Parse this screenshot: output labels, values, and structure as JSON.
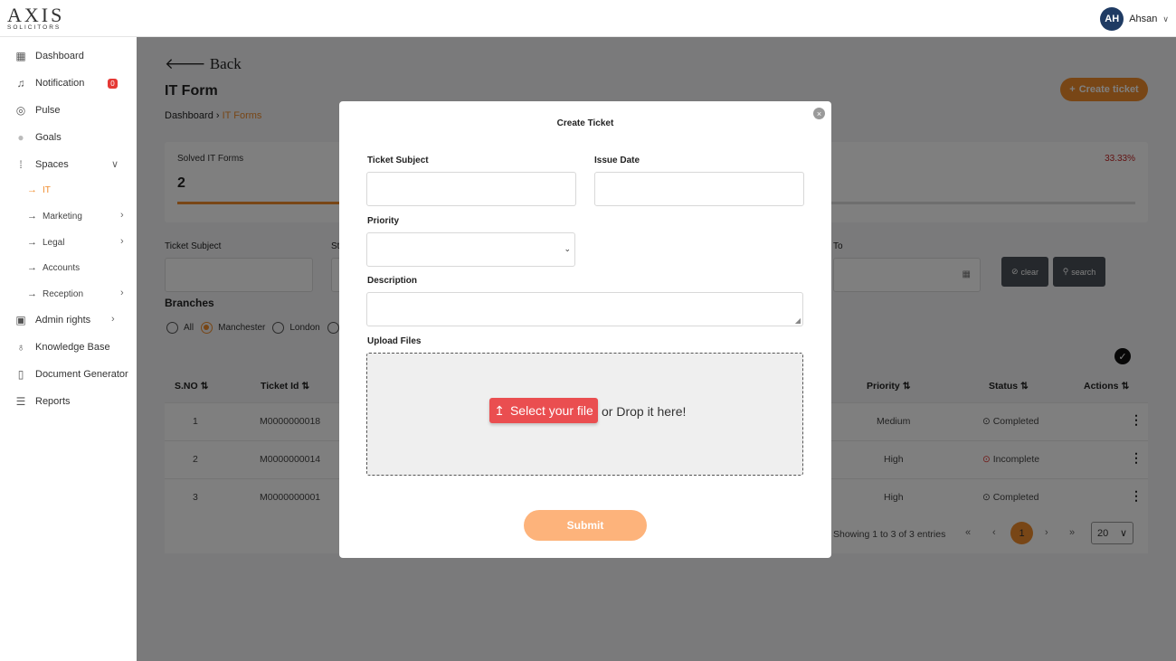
{
  "brand": {
    "name": "AXIS",
    "sub": "SOLICITORS"
  },
  "user": {
    "initials": "AH",
    "name": "Ahsan"
  },
  "sidebar": {
    "items": [
      {
        "label": "Dashboard",
        "icon": "grid-icon"
      },
      {
        "label": "Notification",
        "icon": "bell-icon",
        "badge": "0"
      },
      {
        "label": "Pulse",
        "icon": "signal-icon"
      },
      {
        "label": "Goals",
        "icon": "goal-icon"
      },
      {
        "label": "Spaces",
        "icon": "dots-icon"
      }
    ],
    "spaces": [
      {
        "label": "IT"
      },
      {
        "label": "Marketing"
      },
      {
        "label": "Legal"
      },
      {
        "label": "Accounts"
      },
      {
        "label": "Reception"
      }
    ],
    "bottom_items": [
      {
        "label": "Admin rights",
        "icon": "lock-icon"
      },
      {
        "label": "Knowledge Base",
        "icon": "bulb-icon"
      },
      {
        "label": "Document Generator",
        "icon": "document-icon"
      },
      {
        "label": "Reports",
        "icon": "report-icon"
      }
    ]
  },
  "main": {
    "back": "Back",
    "title": "IT Form",
    "breadcrumb": {
      "home": "Dashboard",
      "current": "IT Forms"
    },
    "create_button": "Create ticket",
    "stat": {
      "label": "Solved IT Forms",
      "value": "2",
      "percent": "33.33%",
      "progress": 0.33
    },
    "filters": {
      "ticket_subject_label": "Ticket Subject",
      "status_label_partial": "St",
      "to_label": "To",
      "clear": "clear",
      "search": "search"
    },
    "branches": {
      "title": "Branches",
      "options": [
        "All",
        "Manchester",
        "London"
      ],
      "selected": "Manchester"
    },
    "table": {
      "headers": [
        "S.NO",
        "Ticket Id",
        "Priority",
        "Status",
        "Actions"
      ],
      "rows": [
        {
          "sno": "1",
          "id": "M0000000018",
          "priority": "Medium",
          "status": "Completed"
        },
        {
          "sno": "2",
          "id": "M0000000014",
          "priority": "High",
          "status": "Incomplete"
        },
        {
          "sno": "3",
          "id": "M0000000001",
          "priority": "High",
          "status": "Completed"
        }
      ]
    },
    "pagination": {
      "summary": "Showing 1 to 3 of 3 entries",
      "first": "«",
      "prev": "‹",
      "current": "1",
      "next": "›",
      "last": "»",
      "page_size": "20"
    }
  },
  "modal": {
    "title": "Create Ticket",
    "ticket_subject": "Ticket Subject",
    "issue_date": "Issue Date",
    "priority": "Priority",
    "description": "Description",
    "upload_files": "Upload Files",
    "select_file": "Select your file",
    "drop_text": "or Drop it here!",
    "submit": "Submit"
  },
  "colors": {
    "accent": "#f08c2c",
    "danger": "#e53935",
    "dark_button": "#4a5058",
    "avatar": "#1f3b63"
  }
}
